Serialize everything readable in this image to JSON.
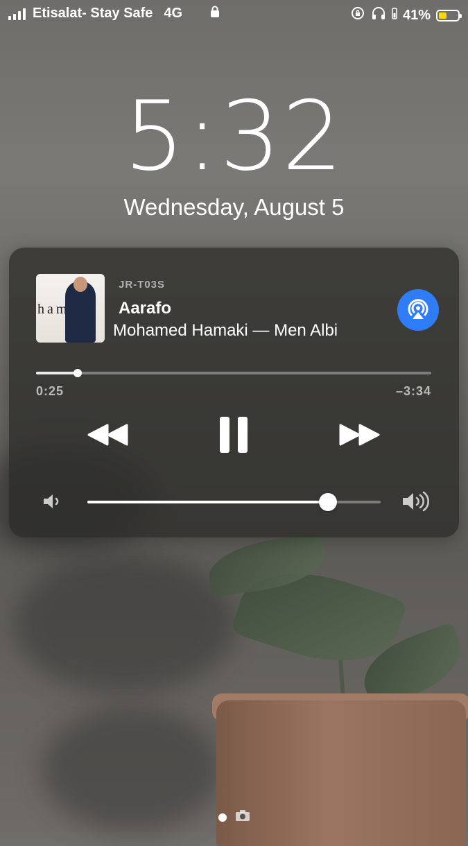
{
  "status_bar": {
    "carrier": "Etisalat- Stay Safe",
    "network": "4G",
    "battery_percent": "41%",
    "battery_level": 0.41,
    "battery_color": "#ffd60a",
    "icons": [
      "signal-icon",
      "lock-icon",
      "orientation-lock-icon",
      "headphones-icon",
      "battery-icon"
    ]
  },
  "lock_screen": {
    "time": "5:32",
    "date": "Wednesday, August 5"
  },
  "now_playing": {
    "device": "JR-T03S",
    "title": "Aarafo",
    "subtitle": "Mohamed Hamaki — Men Albi",
    "elapsed": "0:25",
    "remaining": "–3:34",
    "progress": 0.105,
    "volume": 0.82,
    "airplay_color": "#2f7df6"
  }
}
